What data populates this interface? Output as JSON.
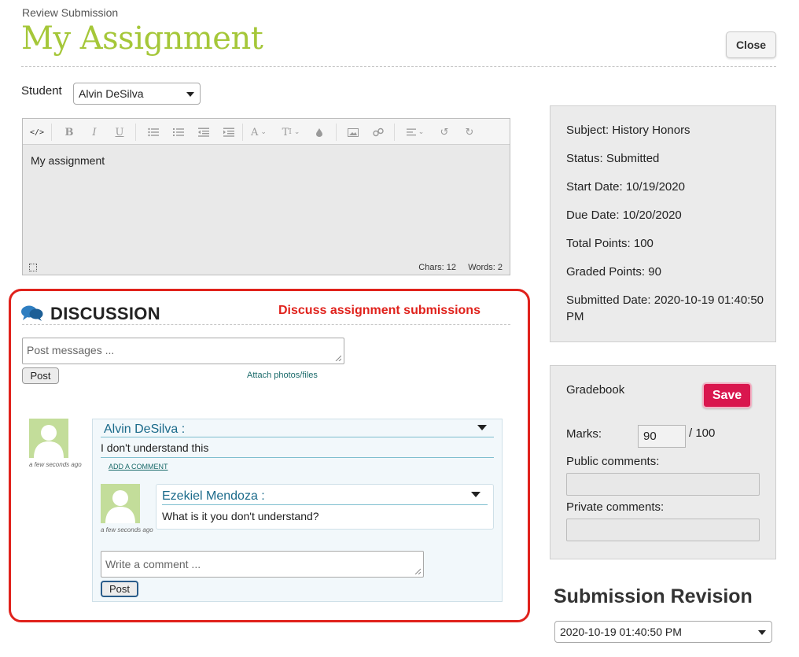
{
  "header": {
    "breadcrumb": "Review Submission",
    "title": "My Assignment",
    "close_label": "Close"
  },
  "student": {
    "label": "Student",
    "selected": "Alvin DeSilva"
  },
  "editor": {
    "toolbar": [
      "code-view-icon",
      "bold-icon",
      "italic-icon",
      "underline-icon",
      "bullet-list-icon",
      "numbered-list-icon",
      "outdent-icon",
      "indent-icon",
      "font-dropdown-icon",
      "text-size-dropdown-icon",
      "color-drop-icon",
      "image-icon",
      "link-icon",
      "align-dropdown-icon",
      "undo-icon",
      "redo-icon"
    ],
    "content": "My assignment",
    "chars": "Chars: 12",
    "words": "Words: 2"
  },
  "discussion": {
    "title": "DISCUSSION",
    "annotation": "Discuss assignment submissions",
    "post_placeholder": "Post messages ...",
    "post_label": "Post",
    "attach_label": "Attach photos/files",
    "comments": [
      {
        "author": "Alvin DeSilva :",
        "text": "I don't understand this",
        "time": "a few seconds ago",
        "add_comment": "ADD A COMMENT",
        "replies": [
          {
            "author": "Ezekiel Mendoza :",
            "text": "What is it you don't understand?",
            "time": "a few seconds ago"
          }
        ]
      }
    ],
    "comment_placeholder": "Write a comment ...",
    "comment_post_label": "Post"
  },
  "info": {
    "subject": "Subject: History Honors",
    "status": "Status: Submitted",
    "start_date": "Start Date: 10/19/2020",
    "due_date": "Due Date: 10/20/2020",
    "total_points": "Total Points: 100",
    "graded_points": "Graded Points: 90",
    "submitted_date": "Submitted Date: 2020-10-19 01:40:50 PM"
  },
  "gradebook": {
    "label": "Gradebook",
    "save_label": "Save",
    "marks_label": "Marks:",
    "marks_value": "90",
    "marks_total": "/ 100",
    "public_label": "Public comments:",
    "private_label": "Private comments:"
  },
  "revision": {
    "title": "Submission Revision",
    "selected": "2020-10-19 01:40:50 PM"
  },
  "colors": {
    "title_green": "#a5c739",
    "highlight_red": "#e0221c",
    "save_pink": "#d9164e",
    "link_teal": "#1a6a8a"
  }
}
